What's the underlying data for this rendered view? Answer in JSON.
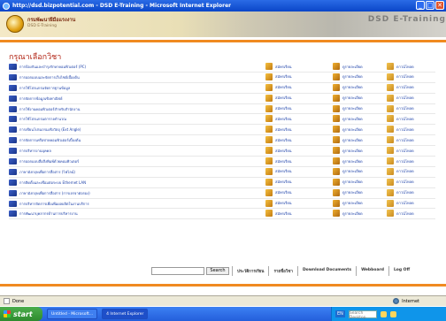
{
  "window": {
    "title": "http://dsd.bizpotential.com - DSD E-Training - Microsoft Internet Explorer",
    "buttons": [
      "_",
      "□",
      "✕"
    ]
  },
  "banner": {
    "org_name": "กรมพัฒนาฝีมือแรงงาน",
    "org_sub": "DSD E-Training",
    "deco_text": "DSD E-Training"
  },
  "page": {
    "heading": "กรุณาเลือกวิชา"
  },
  "actions": {
    "register": "สมัครเรียน",
    "view": "ดูรายละเอียด",
    "docs": "ดาวน์โหลด"
  },
  "courses": [
    {
      "name": "การป้องกันและบำรุงรักษาคอมพิวเตอร์ (PC)"
    },
    {
      "name": "การออกแบบและจัดการเว็บไซต์เบื้องต้น"
    },
    {
      "name": "การใช้โปรแกรมจัดการฐานข้อมูล"
    },
    {
      "name": "การจัดการข้อมูลเชิงพาณิชย์"
    },
    {
      "name": "การใช้งานคอมพิวเตอร์สำหรับสำนักงาน"
    },
    {
      "name": "การใช้โปรแกรมตารางคำนวณ"
    },
    {
      "name": "การเขียนโปรแกรมเชิงวัตถุ (Ext Angle)"
    },
    {
      "name": "การจัดการเครือข่ายคอมพิวเตอร์เบื้องต้น"
    },
    {
      "name": "การบริหารงานบุคคล"
    },
    {
      "name": "การออกแบบสื่อสิ่งพิมพ์ด้วยคอมพิวเตอร์"
    },
    {
      "name": "ภาษาอังกฤษเพื่อการสื่อสาร (ไฟไลน์)"
    },
    {
      "name": "การติดตั้งและเชื่อมต่อระบบ Ethernet LAN"
    },
    {
      "name": "ภาษาอังกฤษเพื่อการสื่อสาร (การเจรจาต่อรอง)"
    },
    {
      "name": "การบริหารจัดการเพื่อเพิ่มผลผลิตในงานบริการ"
    },
    {
      "name": "การพัฒนาบุคลากรด้านการบริหารงาน"
    }
  ],
  "bottom_nav": {
    "search_placeholder": "",
    "search_button": "Search",
    "links": [
      "ประวัติการเรียน",
      "รายชื่อวิชา",
      "Download Documents",
      "Webboard",
      "Log Off"
    ]
  },
  "statusbar": {
    "left": "Done",
    "right": "Internet"
  },
  "taskbar": {
    "start": "start",
    "tasks": [
      "Untitled - Microsoft...",
      "4 Internet Explorer"
    ],
    "lang": "EN",
    "tray_search": "Search Desktop",
    "clock": ""
  }
}
